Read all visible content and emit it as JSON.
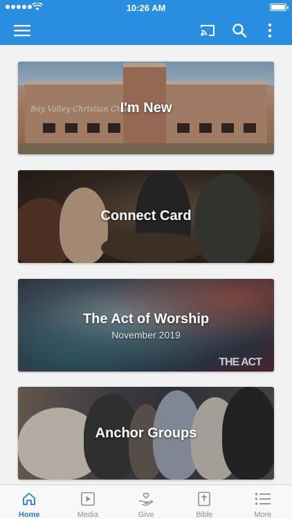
{
  "status_bar": {
    "time": "10:26 AM"
  },
  "app_bar": {
    "menu_icon": "hamburger-menu-icon",
    "cast_icon": "cast-icon",
    "search_icon": "search-icon",
    "more_icon": "more-vertical-icon",
    "color": "#2a8ee0"
  },
  "cards": [
    {
      "title": "I'm New",
      "subtitle": "",
      "image_text": "Bay Valley Christian Church"
    },
    {
      "title": "Connect Card",
      "subtitle": ""
    },
    {
      "title": "The Act of Worship",
      "subtitle": "November 2019",
      "image_text": "THE ACT"
    },
    {
      "title": "Anchor Groups",
      "subtitle": ""
    }
  ],
  "tab_bar": {
    "active_color": "#1e7fd0",
    "items": [
      {
        "label": "Home",
        "icon": "home-icon",
        "active": true
      },
      {
        "label": "Media",
        "icon": "media-play-icon",
        "active": false
      },
      {
        "label": "Give",
        "icon": "give-hand-heart-icon",
        "active": false
      },
      {
        "label": "Bible",
        "icon": "bible-icon",
        "active": false
      },
      {
        "label": "More",
        "icon": "list-more-icon",
        "active": false
      }
    ]
  }
}
